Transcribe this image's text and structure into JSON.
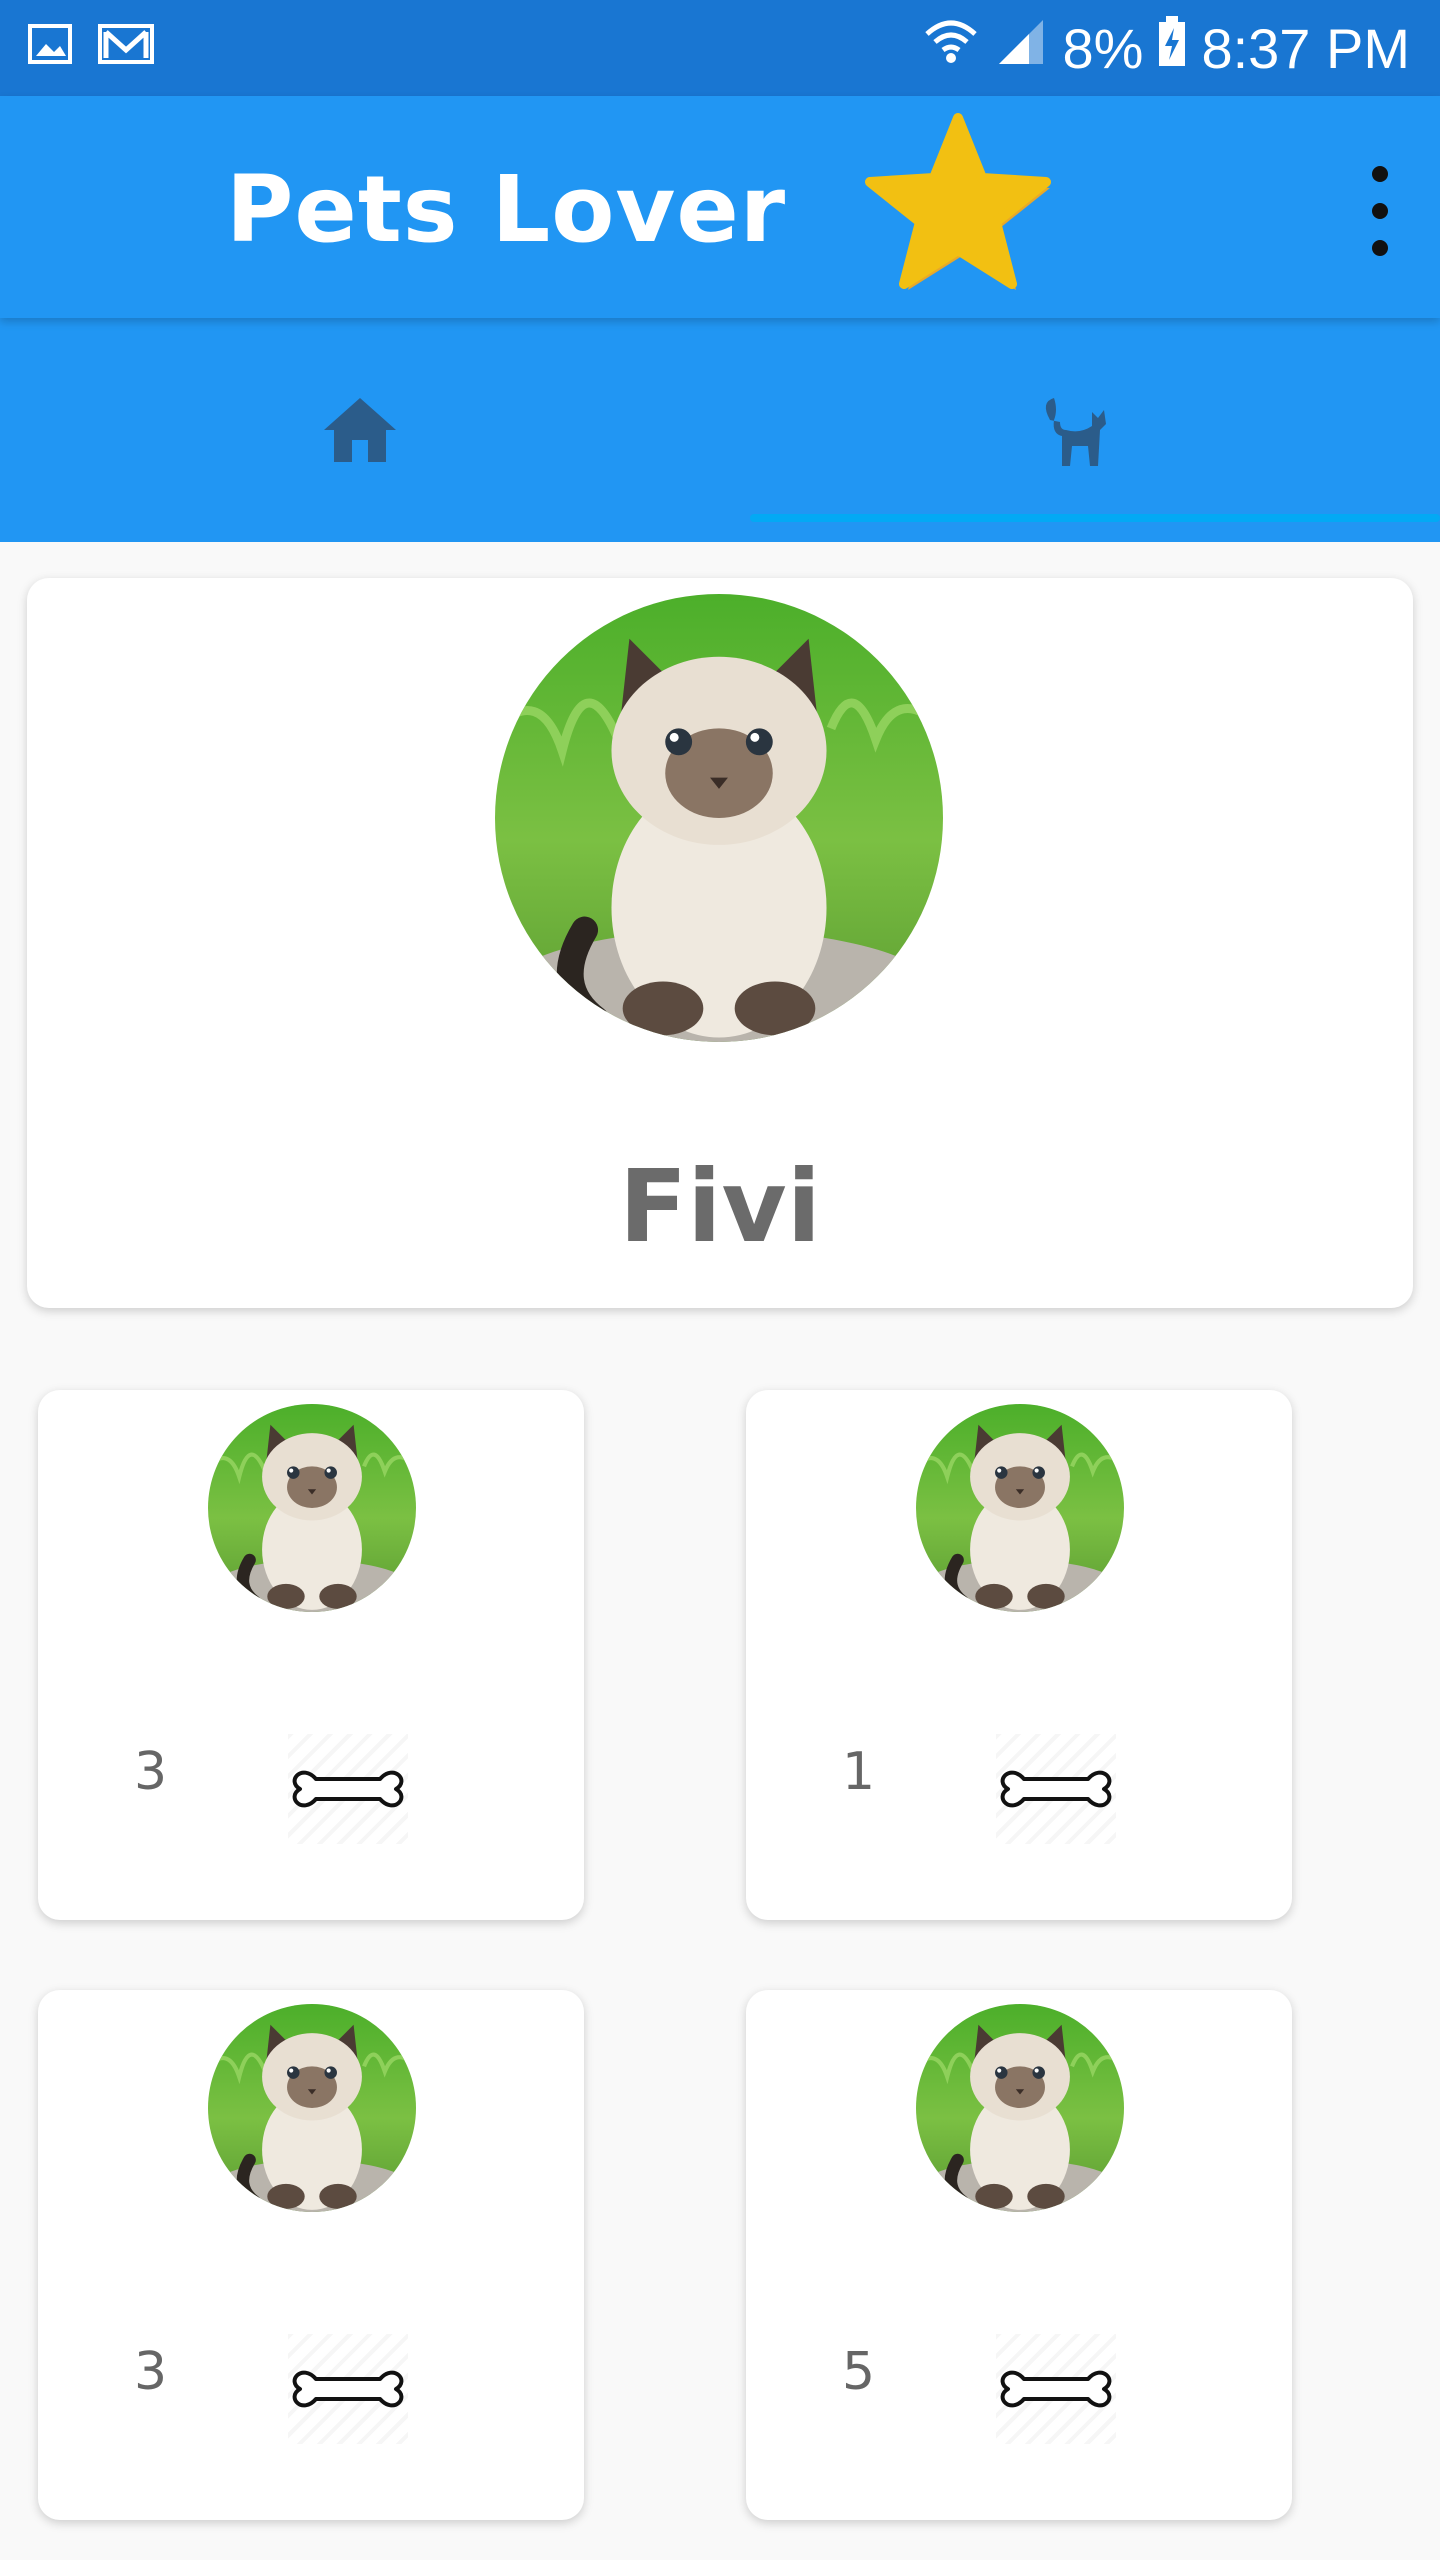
{
  "status_bar": {
    "battery": "8%",
    "time": "8:37 PM"
  },
  "app_bar": {
    "title": "Pets Lover",
    "accent_color": "#2196f3",
    "star_color": "#f2c012"
  },
  "tabs": [
    {
      "icon": "home-icon",
      "selected": false
    },
    {
      "icon": "cat-icon",
      "selected": true
    }
  ],
  "profile": {
    "name": "Fivi",
    "avatar": "kitten-photo"
  },
  "pets": [
    {
      "count": "3",
      "icon": "bone-icon"
    },
    {
      "count": "1",
      "icon": "bone-icon"
    },
    {
      "count": "3",
      "icon": "bone-icon"
    },
    {
      "count": "5",
      "icon": "bone-icon"
    }
  ]
}
